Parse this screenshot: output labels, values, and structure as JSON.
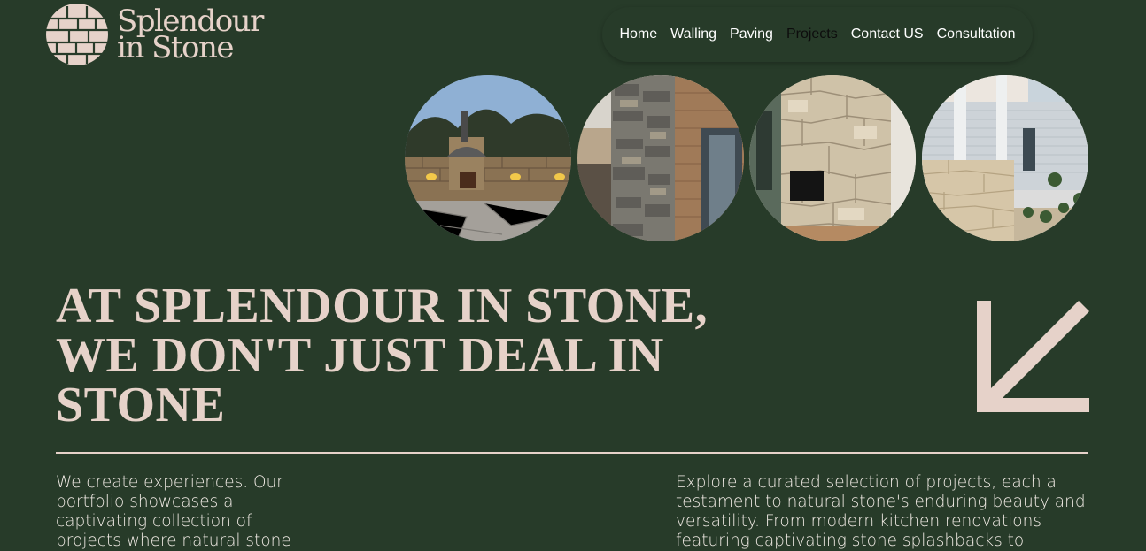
{
  "brand": {
    "line1": "Splendour",
    "line2": "in Stone",
    "logo_icon": "stone-wall-circle-icon"
  },
  "nav": {
    "items": [
      {
        "label": "Home"
      },
      {
        "label": "Walling"
      },
      {
        "label": "Paving"
      },
      {
        "label": "Projects",
        "active": true
      },
      {
        "label": "Contact US"
      },
      {
        "label": "Consultation"
      }
    ]
  },
  "gallery": [
    {
      "subject": "outdoor pizza oven courtyard"
    },
    {
      "subject": "stacked stone pillar"
    },
    {
      "subject": "stone fireplace wall"
    },
    {
      "subject": "stone veranda wall"
    }
  ],
  "hero": {
    "line1": "AT SPLENDOUR IN STONE,",
    "line2": "WE DON'T JUST DEAL IN",
    "line3": "STONE",
    "arrow_icon": "arrow-down-left-icon"
  },
  "intro": {
    "left": "We create experiences. Our portfolio showcases a captivating collection of projects where natural stone",
    "right": "Explore a curated selection of projects, each a testament to natural stone's enduring beauty and versatility. From modern kitchen renovations featuring captivating stone splashbacks to"
  },
  "colors": {
    "background": "#273b29",
    "accent": "#e6d2c9",
    "nav_text": "#ffffff",
    "nav_active": "#0d0d0d"
  }
}
